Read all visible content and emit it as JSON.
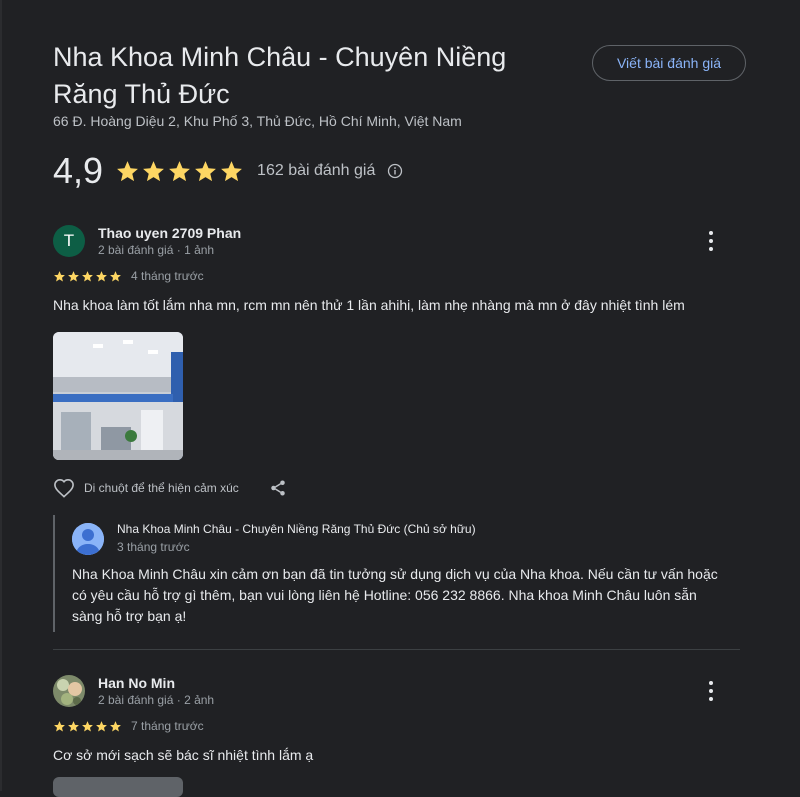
{
  "place": {
    "title": "Nha Khoa Minh Châu - Chuyên Niềng Răng Thủ Đức",
    "address": "66 Đ. Hoàng Diệu 2, Khu Phố 3, Thủ Đức, Hồ Chí Minh, Việt Nam",
    "rating": "4,9",
    "review_count": "162 bài đánh giá",
    "write_review_label": "Viết bài đánh giá"
  },
  "colors": {
    "star": "#fdd663",
    "link": "#8ab4f8",
    "background": "#202124"
  },
  "icons": {
    "star": "star-icon",
    "info": "info-icon",
    "more": "more-vert-icon",
    "heart": "heart-outline-icon",
    "share": "share-icon"
  },
  "reviews": [
    {
      "avatar_letter": "T",
      "author": "Thao uyen 2709 Phan",
      "meta": "2 bài đánh giá · 1 ảnh",
      "stars": 5,
      "date": "4 tháng trước",
      "text": "Nha khoa làm tốt lắm nha mn, rcm mn nên thử 1 lần ahihi, làm nhẹ nhàng mà mn ở đây nhiệt tình lém",
      "reaction_label": "Di chuột để thể hiện cảm xúc",
      "owner_reply": {
        "name": "Nha Khoa Minh Châu - Chuyên Niềng Răng Thủ Đức (Chủ sở hữu)",
        "date": "3 tháng trước",
        "text": "Nha Khoa Minh Châu xin cảm ơn bạn đã tin tưởng sử dụng dịch vụ của Nha khoa. Nếu cần tư vấn hoặc có yêu cầu hỗ trợ gì thêm, bạn vui lòng liên hệ Hotline: 056 232 8866. Nha khoa Minh Châu luôn sẵn sàng hỗ trợ bạn ạ!"
      }
    },
    {
      "author": "Han No Min",
      "meta": "2 bài đánh giá · 2 ảnh",
      "stars": 5,
      "date": "7 tháng trước",
      "text": "Cơ sở mới sạch sẽ bác sĩ nhiệt tình lắm ạ"
    }
  ]
}
